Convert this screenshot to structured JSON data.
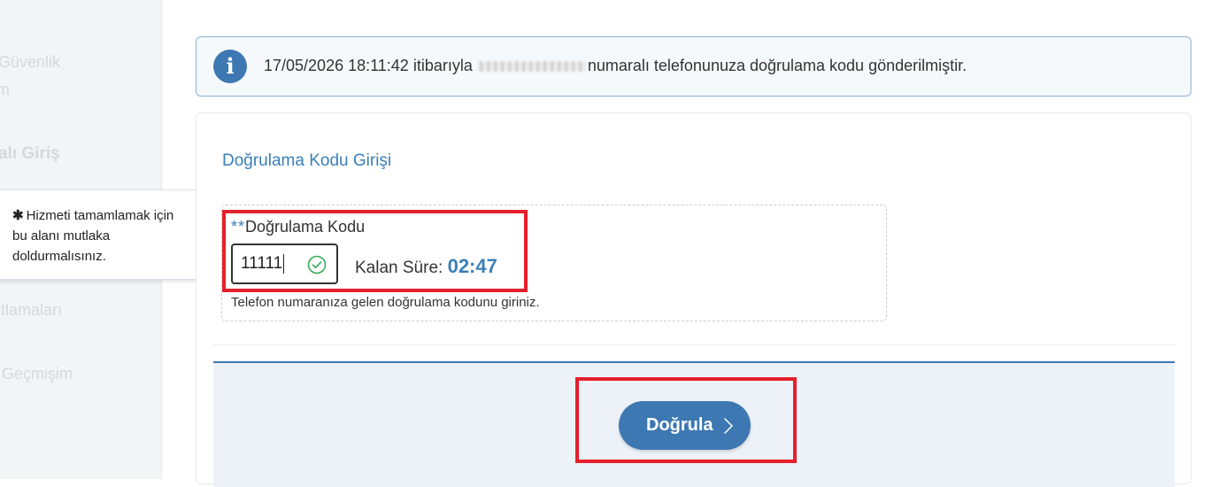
{
  "sidebar": {
    "items": [
      {
        "label": "Güvenlik"
      },
      {
        "label": "m"
      },
      {
        "label": "alı Giriş"
      },
      {
        "label": "ıtlamaları"
      },
      {
        "label": "Geçmişim"
      }
    ]
  },
  "tooltip": {
    "star": "✱",
    "text": "Hizmeti tamamlamak için bu alanı mutlaka doldurmalısınız."
  },
  "info": {
    "icon": "info-icon",
    "prefix": "17/05/2026 18:11:42 itibarıyla",
    "suffix": "numaralı telefonunuza doğrulama kodu gönderilmiştir."
  },
  "form": {
    "section_title": "Doğrulama Kodu Girişi",
    "required_marker": "**",
    "field_label": "Doğrulama Kodu",
    "code_value": "11111",
    "timer_label": "Kalan Süre:",
    "timer_value": "02:47",
    "help_text": "Telefon numaranıza gelen doğrulama kodunu giriniz."
  },
  "actions": {
    "verify_label": "Doğrula"
  },
  "colors": {
    "accent": "#3e78b2",
    "highlight": "#e4202c",
    "valid": "#2ea84f"
  }
}
